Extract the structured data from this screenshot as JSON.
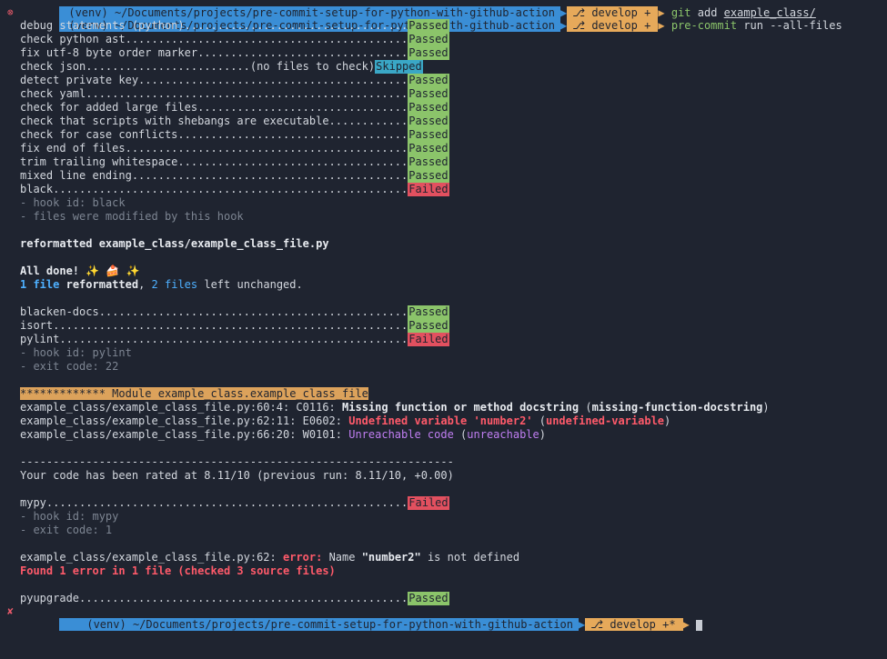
{
  "prompt_prev": {
    "venv": "(venv)",
    "path": "~/Documents/projects/pre-commit-setup-for-python-with-github-action",
    "branch": "develop",
    "cmd_word": "git",
    "cmd_rest": "add",
    "cmd_arg": "example_class/"
  },
  "prompt": {
    "status_icon": "⊗",
    "venv": "(venv)",
    "path": "~/Documents/projects/pre-commit-setup-for-python-with-github-action",
    "branch": "develop",
    "dirty": "+",
    "cmd_word": "pre-commit",
    "cmd_rest": "run --all-files"
  },
  "hooks_a": [
    {
      "label": "debug statements (python)..................................",
      "status": "Passed"
    },
    {
      "label": "check python ast...........................................",
      "status": "Passed"
    },
    {
      "label": "fix utf-8 byte order marker................................",
      "status": "Passed"
    },
    {
      "label": "check json.........................(no files to check)",
      "status": "Skipped"
    },
    {
      "label": "detect private key.........................................",
      "status": "Passed"
    },
    {
      "label": "check yaml.................................................",
      "status": "Passed"
    },
    {
      "label": "check for added large files................................",
      "status": "Passed"
    },
    {
      "label": "check that scripts with shebangs are executable............",
      "status": "Passed"
    },
    {
      "label": "check for case conflicts...................................",
      "status": "Passed"
    },
    {
      "label": "fix end of files...........................................",
      "status": "Passed"
    },
    {
      "label": "trim trailing whitespace...................................",
      "status": "Passed"
    },
    {
      "label": "mixed line ending..........................................",
      "status": "Passed"
    },
    {
      "label": "black......................................................",
      "status": "Failed"
    }
  ],
  "black": {
    "hook_id": "- hook id: black",
    "modified": "- files were modified by this hook",
    "reformatted": "reformatted example_class/example_class_file.py",
    "done": "All done! ✨ 🍰 ✨",
    "summary_count": "1 file",
    "summary_word": "reformatted",
    "summary_sep": ",",
    "summary_count2": "2 files",
    "summary_tail": "left unchanged."
  },
  "hooks_b": [
    {
      "label": "blacken-docs...............................................",
      "status": "Passed"
    },
    {
      "label": "isort......................................................",
      "status": "Passed"
    },
    {
      "label": "pylint.....................................................",
      "status": "Failed"
    }
  ],
  "pylint": {
    "hook_id": "- hook id: pylint",
    "exit_code": "- exit code: 22",
    "module_header": "************* Module example_class.example_class_file",
    "m1_loc": "example_class/example_class_file.py:60:4: C0116: ",
    "m1_msg": "Missing function or method docstring",
    "m1_code": "missing-function-docstring",
    "m2_loc": "example_class/example_class_file.py:62:11: E0602: ",
    "m2_msg": "Undefined variable 'number2'",
    "m2_code": "undefined-variable",
    "m3_loc": "example_class/example_class_file.py:66:20: W0101: ",
    "m3_msg": "Unreachable code",
    "m3_code": "unreachable",
    "rule": "------------------------------------------------------------------",
    "rating": "Your code has been rated at 8.11/10 (previous run: 8.11/10, +0.00)"
  },
  "hooks_c": [
    {
      "label": "mypy.......................................................",
      "status": "Failed"
    }
  ],
  "mypy": {
    "hook_id": "- hook id: mypy",
    "exit_code": "- exit code: 1",
    "loc": "example_class/example_class_file.py:62: ",
    "err_word": "error:",
    "msg_pre": " Name ",
    "msg_name": "\"number2\"",
    "msg_post": " is not defined",
    "found": "Found 1 error in 1 file (checked 3 source files)"
  },
  "hooks_d": [
    {
      "label": "pyupgrade..................................................",
      "status": "Passed"
    }
  ],
  "prompt_next": {
    "status_icon": "✘",
    "venv": "(venv)",
    "path": "~/Documents/projects/pre-commit-setup-for-python-with-github-action",
    "branch": "develop",
    "dirty": "+*"
  }
}
